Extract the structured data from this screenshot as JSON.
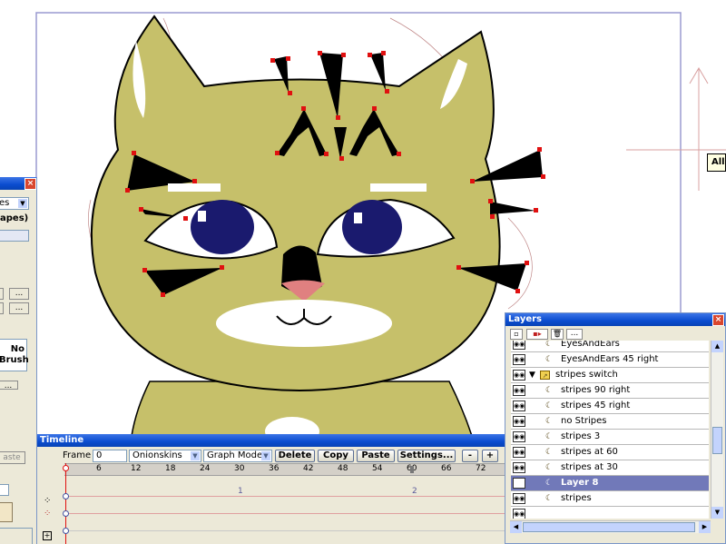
{
  "tooltip": {
    "text": "All"
  },
  "tool_panel": {
    "dropdown_value": "es",
    "label": "apes)",
    "no_brush_label": "No\nBrush",
    "more_1": "...",
    "more_2": "...",
    "more_3": "...",
    "paste_label": "aste"
  },
  "timeline": {
    "title": "Timeline",
    "frame_label": "Frame",
    "frame_value": "0",
    "onionskins": "Onionskins",
    "graph_mode": "Graph Mode",
    "buttons": {
      "delete": "Delete",
      "copy": "Copy",
      "paste": "Paste",
      "settings": "Settings...",
      "minus": "-",
      "plus": "+"
    },
    "ruler_ticks": [
      "6",
      "12",
      "18",
      "24",
      "30",
      "36",
      "42",
      "48",
      "54",
      "60",
      "66",
      "72"
    ],
    "second_markers": [
      "1",
      "2"
    ]
  },
  "layers": {
    "title": "Layers",
    "items": [
      {
        "name": "EyesAndEars",
        "indent": 1,
        "type": "layer"
      },
      {
        "name": "EyesAndEars 45 right",
        "indent": 1,
        "type": "layer"
      },
      {
        "name": "stripes switch",
        "indent": 0,
        "type": "switch"
      },
      {
        "name": "stripes 90 right",
        "indent": 1,
        "type": "layer"
      },
      {
        "name": "stripes 45 right",
        "indent": 1,
        "type": "layer"
      },
      {
        "name": "no Stripes",
        "indent": 1,
        "type": "layer"
      },
      {
        "name": "stripes 3",
        "indent": 1,
        "type": "layer"
      },
      {
        "name": "stripes at 60",
        "indent": 1,
        "type": "layer"
      },
      {
        "name": "stripes at 30",
        "indent": 1,
        "type": "layer"
      },
      {
        "name": "Layer 8",
        "indent": 1,
        "type": "layer",
        "selected": true
      },
      {
        "name": "stripes",
        "indent": 1,
        "type": "layer"
      }
    ]
  },
  "colors": {
    "cat_fur": "#c6c06a",
    "eye_iris": "#1a1a6e",
    "nose_pink": "#e08080",
    "selection": "#7179b9",
    "titlebar": "#0a4ccf"
  }
}
